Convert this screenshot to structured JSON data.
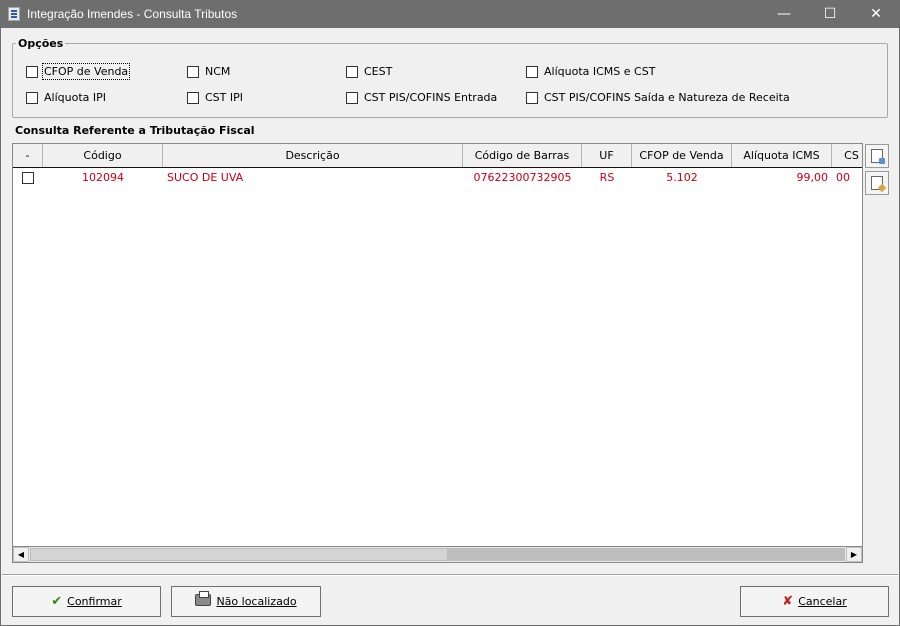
{
  "window": {
    "title": "Integração Imendes - Consulta Tributos",
    "controls": {
      "minimize": "—",
      "maximize": "☐",
      "close": "✕"
    }
  },
  "options": {
    "title": "Opções",
    "checkboxes": [
      {
        "label": "CFOP de Venda",
        "checked": false
      },
      {
        "label": "NCM",
        "checked": false
      },
      {
        "label": "CEST",
        "checked": false
      },
      {
        "label": "Alíquota ICMS e CST",
        "checked": false
      },
      {
        "label": "Alíquota IPI",
        "checked": false
      },
      {
        "label": "CST IPI",
        "checked": false
      },
      {
        "label": "CST PIS/COFINS Entrada",
        "checked": false
      },
      {
        "label": "CST PIS/COFINS Saída e Natureza de Receita",
        "checked": false
      }
    ]
  },
  "grid": {
    "title": "Consulta Referente a Tributação Fiscal",
    "columns": [
      "-",
      "Código",
      "Descrição",
      "Código de Barras",
      "UF",
      "CFOP de Venda",
      "Alíquota ICMS",
      "CS"
    ],
    "rows": [
      {
        "checked": false,
        "codigo": "102094",
        "descricao": "SUCO DE UVA",
        "barras": "07622300732905",
        "uf": "RS",
        "cfop": "5.102",
        "aliquota": "99,00",
        "cst": "00"
      }
    ]
  },
  "buttons": {
    "confirm": "Confirmar",
    "not_found": "Não localizado",
    "cancel": "Cancelar"
  },
  "colors": {
    "titlebar": "#6e6e6e",
    "row_text": "#c0001a"
  }
}
